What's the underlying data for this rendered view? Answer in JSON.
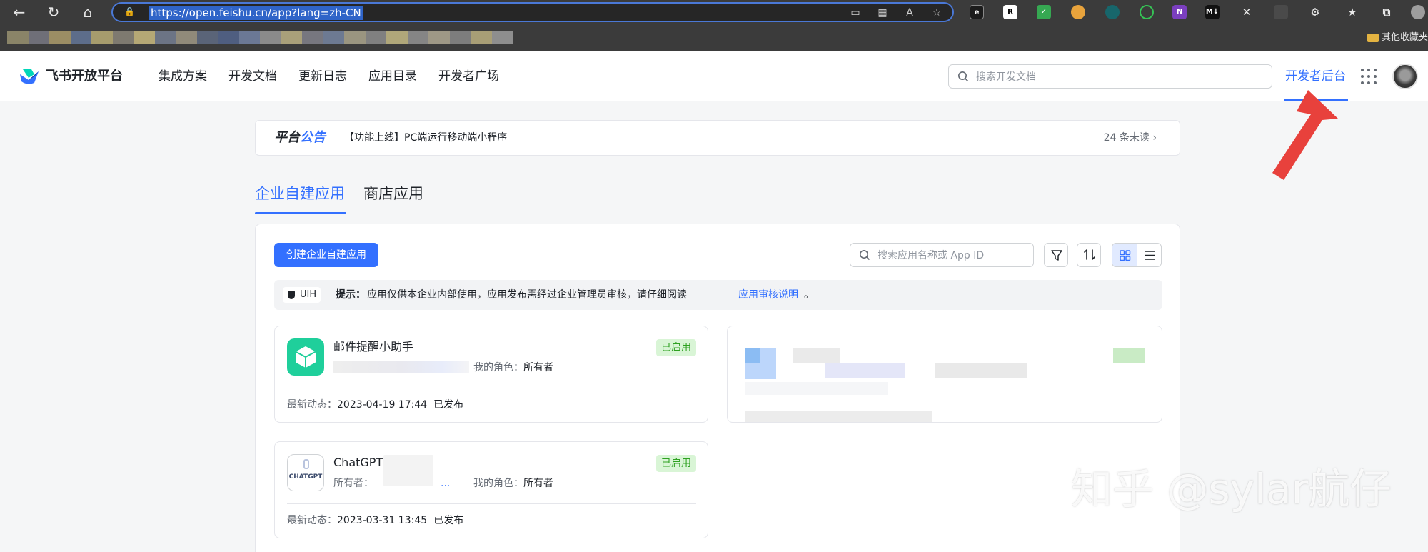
{
  "browser": {
    "url": "https://open.feishu.cn/app?lang=zh-CN",
    "bookmark_folder": "其他收藏夹"
  },
  "header": {
    "logo_text": "飞书开放平台",
    "nav": [
      "集成方案",
      "开发文档",
      "更新日志",
      "应用目录",
      "开发者广场"
    ],
    "search_placeholder": "搜索开发文档",
    "dev_console": "开发者后台"
  },
  "notice": {
    "title_prefix": "平台",
    "title_highlight": "公告",
    "text": "【功能上线】PC端运行移动端小程序",
    "unread": "24 条未读 ›"
  },
  "tabs": [
    {
      "label": "企业自建应用",
      "active": true
    },
    {
      "label": "商店应用",
      "active": false
    }
  ],
  "toolbar": {
    "create_button": "创建企业自建应用",
    "search_placeholder": "搜索应用名称或 App ID"
  },
  "tip": {
    "badge": "UIH",
    "label": "提示：",
    "text": "应用仅供本企业内部使用，应用发布需经过企业管理员审核，请仔细阅读",
    "link": "应用审核说明",
    "period": "。"
  },
  "apps": [
    {
      "name": "邮件提醒小助手",
      "owner": "",
      "role_label": "我的角色：",
      "role": "所有者",
      "status": "已启用",
      "latest_label": "最新动态：",
      "latest_time": "2023-04-19 17:44",
      "latest_state": "已发布",
      "icon_color": "#1fcf9b"
    },
    {
      "name": "ChatGPT",
      "owner": "所有者：",
      "owner_suffix": "...",
      "role_label": "我的角色：",
      "role": "所有者",
      "status": "已启用",
      "icon_text": "CHATGPT",
      "latest_label": "最新动态：",
      "latest_time": "2023-03-31 13:45",
      "latest_state": "已发布"
    }
  ],
  "watermark": "知乎 @sylar航仔",
  "colors": {
    "accent": "#3370ff",
    "success_bg": "#d9f5d6",
    "success_text": "#2ea121",
    "annotation": "#e8413c"
  }
}
